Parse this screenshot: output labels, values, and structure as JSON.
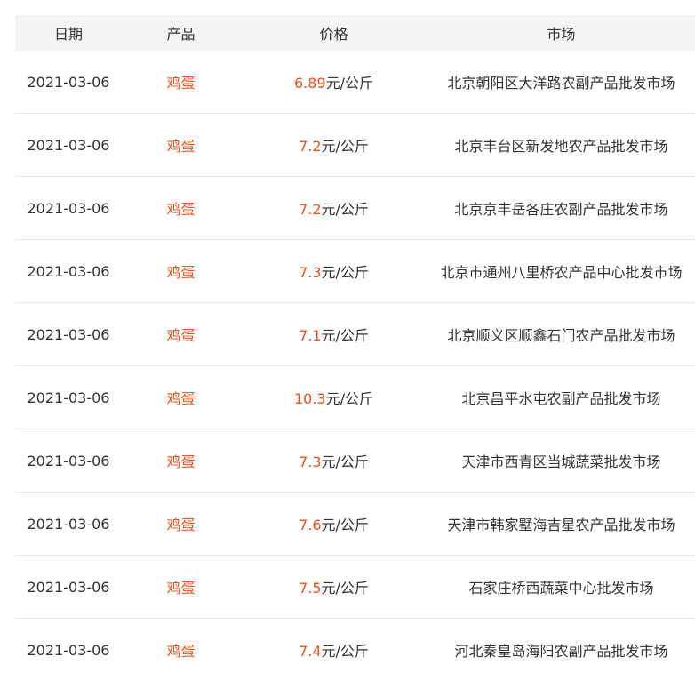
{
  "colors": {
    "accent": "#e8501c",
    "text": "#333333",
    "header_bg": "#f4f4f4",
    "divider": "#e8e8e8"
  },
  "table": {
    "headers": {
      "date": "日期",
      "product": "产品",
      "price": "价格",
      "market": "市场"
    },
    "rows": [
      {
        "date": "2021-03-06",
        "product": "鸡蛋",
        "price": "6.89",
        "unit": "元/公斤",
        "market": "北京朝阳区大洋路农副产品批发市场"
      },
      {
        "date": "2021-03-06",
        "product": "鸡蛋",
        "price": "7.2",
        "unit": "元/公斤",
        "market": "北京丰台区新发地农产品批发市场"
      },
      {
        "date": "2021-03-06",
        "product": "鸡蛋",
        "price": "7.2",
        "unit": "元/公斤",
        "market": "北京京丰岳各庄农副产品批发市场"
      },
      {
        "date": "2021-03-06",
        "product": "鸡蛋",
        "price": "7.3",
        "unit": "元/公斤",
        "market": "北京市通州八里桥农产品中心批发市场"
      },
      {
        "date": "2021-03-06",
        "product": "鸡蛋",
        "price": "7.1",
        "unit": "元/公斤",
        "market": "北京顺义区顺鑫石门农产品批发市场"
      },
      {
        "date": "2021-03-06",
        "product": "鸡蛋",
        "price": "10.3",
        "unit": "元/公斤",
        "market": "北京昌平水屯农副产品批发市场"
      },
      {
        "date": "2021-03-06",
        "product": "鸡蛋",
        "price": "7.3",
        "unit": "元/公斤",
        "market": "天津市西青区当城蔬菜批发市场"
      },
      {
        "date": "2021-03-06",
        "product": "鸡蛋",
        "price": "7.6",
        "unit": "元/公斤",
        "market": "天津市韩家墅海吉星农产品批发市场"
      },
      {
        "date": "2021-03-06",
        "product": "鸡蛋",
        "price": "7.5",
        "unit": "元/公斤",
        "market": "石家庄桥西蔬菜中心批发市场"
      },
      {
        "date": "2021-03-06",
        "product": "鸡蛋",
        "price": "7.4",
        "unit": "元/公斤",
        "market": "河北秦皇岛海阳农副产品批发市场"
      }
    ]
  }
}
